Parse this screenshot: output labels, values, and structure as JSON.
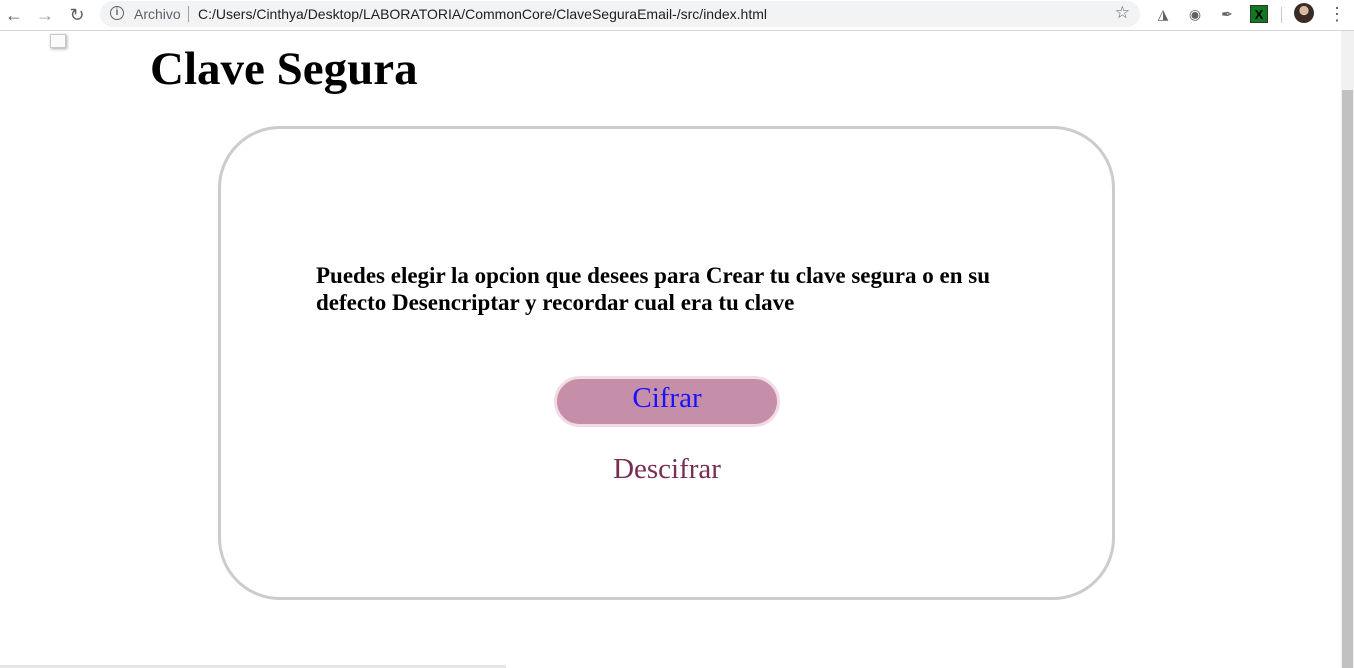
{
  "browser": {
    "scheme_label": "Archivo",
    "url": "C:/Users/Cinthya/Desktop/LABORATORIA/CommonCore/ClaveSeguraEmail-/src/index.html",
    "extension_x_label": "X"
  },
  "page": {
    "title": "Clave Segura",
    "description": "Puedes elegir la opcion que desees para Crear tu clave segura o en su defecto Desencriptar y recordar cual era tu clave",
    "cifrar_label": "Cifrar",
    "descifrar_label": "Descifrar"
  },
  "colors": {
    "button_bg": "#c68fa9",
    "button_text": "#1a12ff",
    "descifrar_text": "#7a2d52",
    "card_border": "#cccccc"
  },
  "icons": [
    "back-arrow-icon",
    "forward-arrow-icon",
    "reload-icon",
    "info-icon",
    "star-icon",
    "pocket-icon",
    "tomato-icon",
    "eyedropper-icon",
    "extension-x-icon",
    "avatar",
    "menu-dots-icon",
    "broken-image-icon"
  ]
}
